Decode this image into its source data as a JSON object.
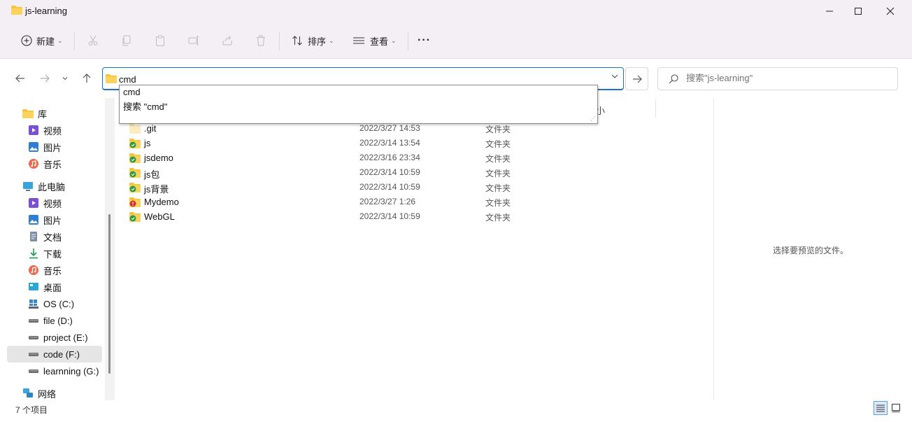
{
  "window": {
    "title": "js-learning"
  },
  "window_controls": {
    "minimize": "—",
    "maximize": "☐",
    "close": "✕"
  },
  "commandbar": {
    "new_label": "新建",
    "sort_label": "排序",
    "view_label": "查看",
    "more_label": "···"
  },
  "address": {
    "value": "cmd"
  },
  "search": {
    "placeholder": "搜索\"js-learning\""
  },
  "autocomplete": {
    "items": [
      "cmd",
      "搜索 \"cmd\""
    ]
  },
  "sidebar": {
    "items": [
      {
        "label": "库",
        "icon": "library-folder-icon"
      },
      {
        "label": "视频",
        "icon": "videos-icon"
      },
      {
        "label": "图片",
        "icon": "pictures-icon"
      },
      {
        "label": "音乐",
        "icon": "music-icon"
      },
      {
        "label": "此电脑",
        "icon": "this-pc-icon"
      },
      {
        "label": "视频",
        "icon": "videos-icon"
      },
      {
        "label": "图片",
        "icon": "pictures-icon"
      },
      {
        "label": "文档",
        "icon": "documents-icon"
      },
      {
        "label": "下载",
        "icon": "downloads-icon"
      },
      {
        "label": "音乐",
        "icon": "music-icon"
      },
      {
        "label": "桌面",
        "icon": "desktop-icon"
      },
      {
        "label": "OS (C:)",
        "icon": "windows-drive-icon"
      },
      {
        "label": "file (D:)",
        "icon": "drive-icon"
      },
      {
        "label": "project (E:)",
        "icon": "drive-icon"
      },
      {
        "label": "code (F:)",
        "icon": "drive-icon",
        "selected": true
      },
      {
        "label": "learnning (G:)",
        "icon": "drive-icon"
      },
      {
        "label": "网络",
        "icon": "network-icon"
      }
    ]
  },
  "filelist": {
    "columns": {
      "size_partial": "小"
    },
    "rows": [
      {
        "name": ".git",
        "date": "2022/3/27 14:53",
        "type": "文件夹",
        "status": "none"
      },
      {
        "name": "js",
        "date": "2022/3/14 13:54",
        "type": "文件夹",
        "status": "ok"
      },
      {
        "name": "jsdemo",
        "date": "2022/3/16 23:34",
        "type": "文件夹",
        "status": "ok"
      },
      {
        "name": "js包",
        "date": "2022/3/14 10:59",
        "type": "文件夹",
        "status": "ok"
      },
      {
        "name": "js背景",
        "date": "2022/3/14 10:59",
        "type": "文件夹",
        "status": "ok"
      },
      {
        "name": "Mydemo",
        "date": "2022/3/27 1:26",
        "type": "文件夹",
        "status": "error"
      },
      {
        "name": "WebGL",
        "date": "2022/3/14 10:59",
        "type": "文件夹",
        "status": "ok"
      }
    ]
  },
  "preview": {
    "text": "选择要预览的文件。"
  },
  "status": {
    "text": "7 个项目"
  },
  "colors": {
    "accent": "#1a73c9",
    "folder": "#f8c33a",
    "ok": "#2b9a3c",
    "error": "#d93025"
  }
}
